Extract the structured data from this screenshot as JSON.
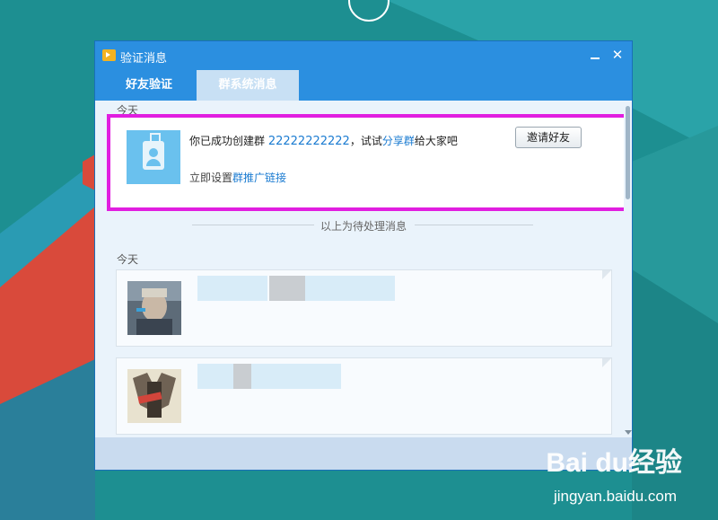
{
  "window": {
    "title": "验证消息",
    "close_glyph": "✕"
  },
  "tabs": [
    {
      "label": "好友验证",
      "active": false
    },
    {
      "label": "群系统消息",
      "active": true
    }
  ],
  "pending": {
    "section_label": "今天",
    "msg_prefix": "你已成功创建群",
    "group_number": "22222222222",
    "msg_middle": "，试试",
    "share_link": "分享群",
    "msg_suffix": "给大家吧",
    "invite_button": "邀请好友",
    "setup_prefix": "立即设置",
    "setup_link": "群推广链接"
  },
  "divider_text": "以上为待处理消息",
  "history": {
    "section_label": "今天"
  },
  "watermark": {
    "brand": "Bai du经验",
    "domain": "jingyan.baidu.com"
  },
  "colors": {
    "titlebar": "#2b8fe0",
    "highlight": "#e11ee0",
    "link": "#1a7bd1"
  }
}
